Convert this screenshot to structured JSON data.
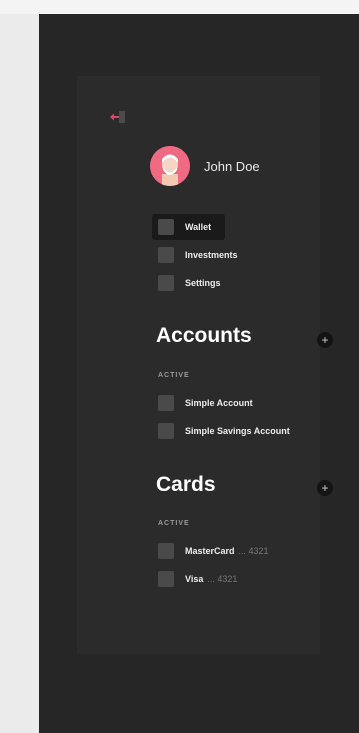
{
  "colors": {
    "panel": "#262626",
    "accent_logout": "#e0456a",
    "avatar_bg": "#f06a84"
  },
  "logout_icon": "logout-icon",
  "user": {
    "name": "John Doe",
    "avatar_icon": "user-avatar"
  },
  "nav": [
    {
      "label": "Wallet",
      "active": true
    },
    {
      "label": "Investments",
      "active": false
    },
    {
      "label": "Settings",
      "active": false
    }
  ],
  "accounts": {
    "title": "Accounts",
    "add_icon": "plus-icon",
    "subhead": "ACTIVE",
    "items": [
      {
        "label": "Simple Account"
      },
      {
        "label": "Simple Savings Account"
      }
    ]
  },
  "cards": {
    "title": "Cards",
    "add_icon": "plus-icon",
    "subhead": "ACTIVE",
    "items": [
      {
        "label": "MasterCard",
        "suffix": "... 4321"
      },
      {
        "label": "Visa",
        "suffix": "... 4321"
      }
    ]
  }
}
